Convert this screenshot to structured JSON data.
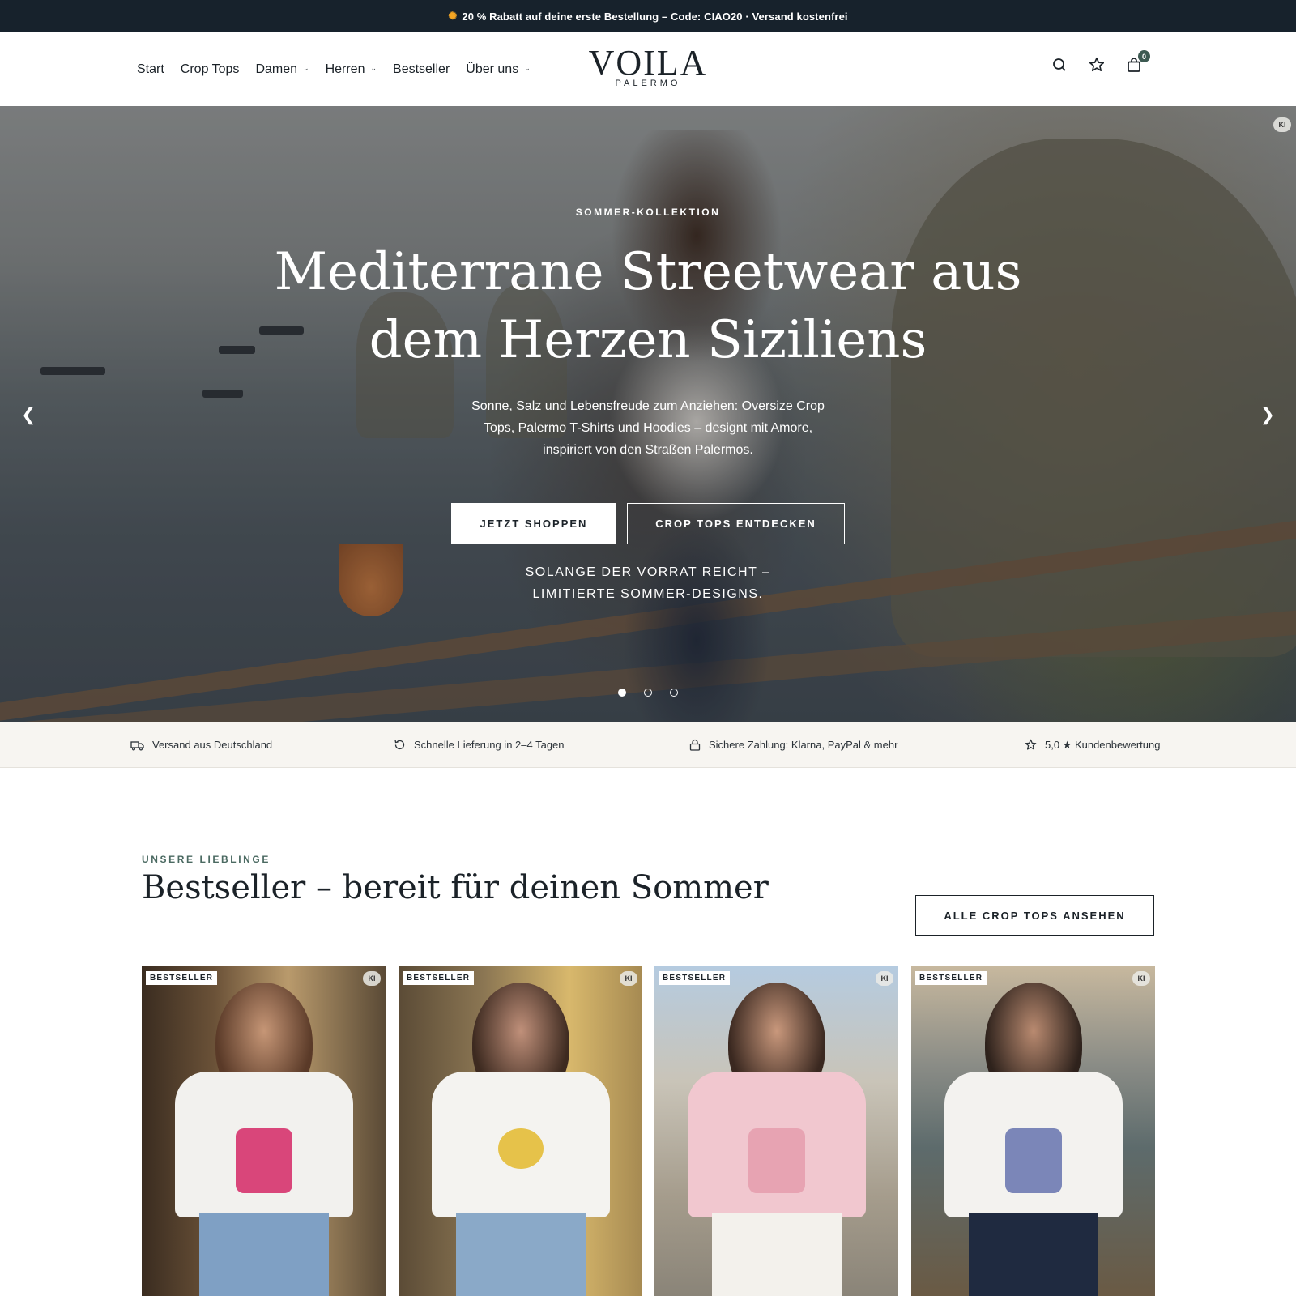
{
  "announcement": {
    "icon": "sun-icon",
    "text": "20 % Rabatt auf deine erste Bestellung – Code: CIAO20 · Versand kostenfrei"
  },
  "header": {
    "nav": [
      {
        "label": "Start",
        "has_dropdown": false
      },
      {
        "label": "Crop Tops",
        "has_dropdown": false
      },
      {
        "label": "Damen",
        "has_dropdown": true
      },
      {
        "label": "Herren",
        "has_dropdown": true
      },
      {
        "label": "Bestseller",
        "has_dropdown": false
      },
      {
        "label": "Über uns",
        "has_dropdown": true
      }
    ],
    "logo": {
      "line1": "VOILA",
      "line2": "PALERMO"
    },
    "icons": [
      "search-icon",
      "star-icon",
      "cart-icon"
    ],
    "cart_count": "0"
  },
  "hero": {
    "ki_badge": "KI",
    "eyebrow": "SOMMER-KOLLEKTION",
    "title_line1": "Mediterrane Streetwear aus",
    "title_line2": "dem Herzen Siziliens",
    "subtitle": "Sonne, Salz und Lebensfreude zum Anziehen: Oversize Crop Tops, Palermo T-Shirts und Hoodies – designt mit Amore, inspiriert von den Straßen Palermos.",
    "primary_button": "JETZT SHOPPEN",
    "secondary_button": "CROP TOPS ENTDECKEN",
    "note_line1": "SOLANGE DER VORRAT REICHT –",
    "note_line2": "LIMITIERTE SOMMER-DESIGNS.",
    "prev_arrow": "❮",
    "next_arrow": "❯",
    "slides": 3,
    "active_slide": 1
  },
  "trust": [
    {
      "icon": "truck-icon",
      "text": "Versand aus Deutschland"
    },
    {
      "icon": "refresh-icon",
      "text": "Schnelle Lieferung in 2–4 Tagen"
    },
    {
      "icon": "lock-icon",
      "text": "Sichere Zahlung: Klarna, PayPal & mehr"
    },
    {
      "icon": "star-icon",
      "text": "5,0 ★ Kundenbewertung"
    }
  ],
  "bestseller": {
    "eyebrow": "UNSERE LIEBLINGE",
    "title": "Bestseller – bereit für deinen Sommer",
    "button": "ALLE CROP TOPS ANSEHEN",
    "products": [
      {
        "badge": "BESTSELLER",
        "ki": "KI",
        "tee_color": "#f2f1ee",
        "print_color": "#d9467a"
      },
      {
        "badge": "BESTSELLER",
        "ki": "KI",
        "tee_color": "#f4f3f0",
        "print_color": "#e6c24a"
      },
      {
        "badge": "BESTSELLER",
        "ki": "KI",
        "tee_color": "#f1c7cf",
        "print_color": "#e7a3b2"
      },
      {
        "badge": "BESTSELLER",
        "ki": "KI",
        "tee_color": "#f3f2ef",
        "print_color": "#7b86b8"
      }
    ]
  },
  "colors": {
    "announcement_bg": "#17222c",
    "accent": "#3d5a52",
    "trust_bg": "#f7f5f1"
  }
}
